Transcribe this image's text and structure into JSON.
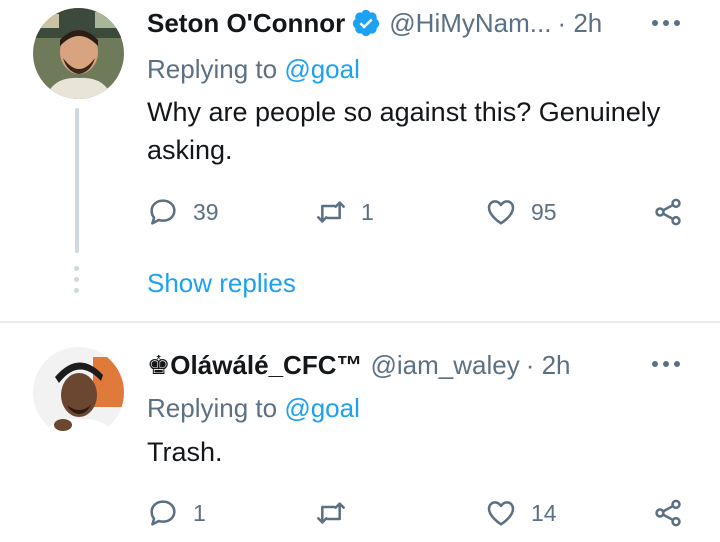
{
  "tweets": [
    {
      "name": "Seton O'Connor",
      "verified": true,
      "handle": "@HiMyNam...",
      "time": "· 2h",
      "replying_label": "Replying to",
      "replying_to": "@goal",
      "text": "Why are people so against this? Genuinely asking.",
      "replies": "39",
      "retweets": "1",
      "likes": "95"
    },
    {
      "name": "♚Oláwálé_CFC™",
      "handle": "@iam_waley",
      "time": "· 2h",
      "replying_label": "Replying to",
      "replying_to": "@goal",
      "text": "Trash.",
      "replies": "1",
      "retweets": "",
      "likes": "14"
    }
  ],
  "show_replies": "Show replies",
  "colors": {
    "accent": "#1da1f2",
    "muted": "#5b7083",
    "text": "#14171a"
  }
}
